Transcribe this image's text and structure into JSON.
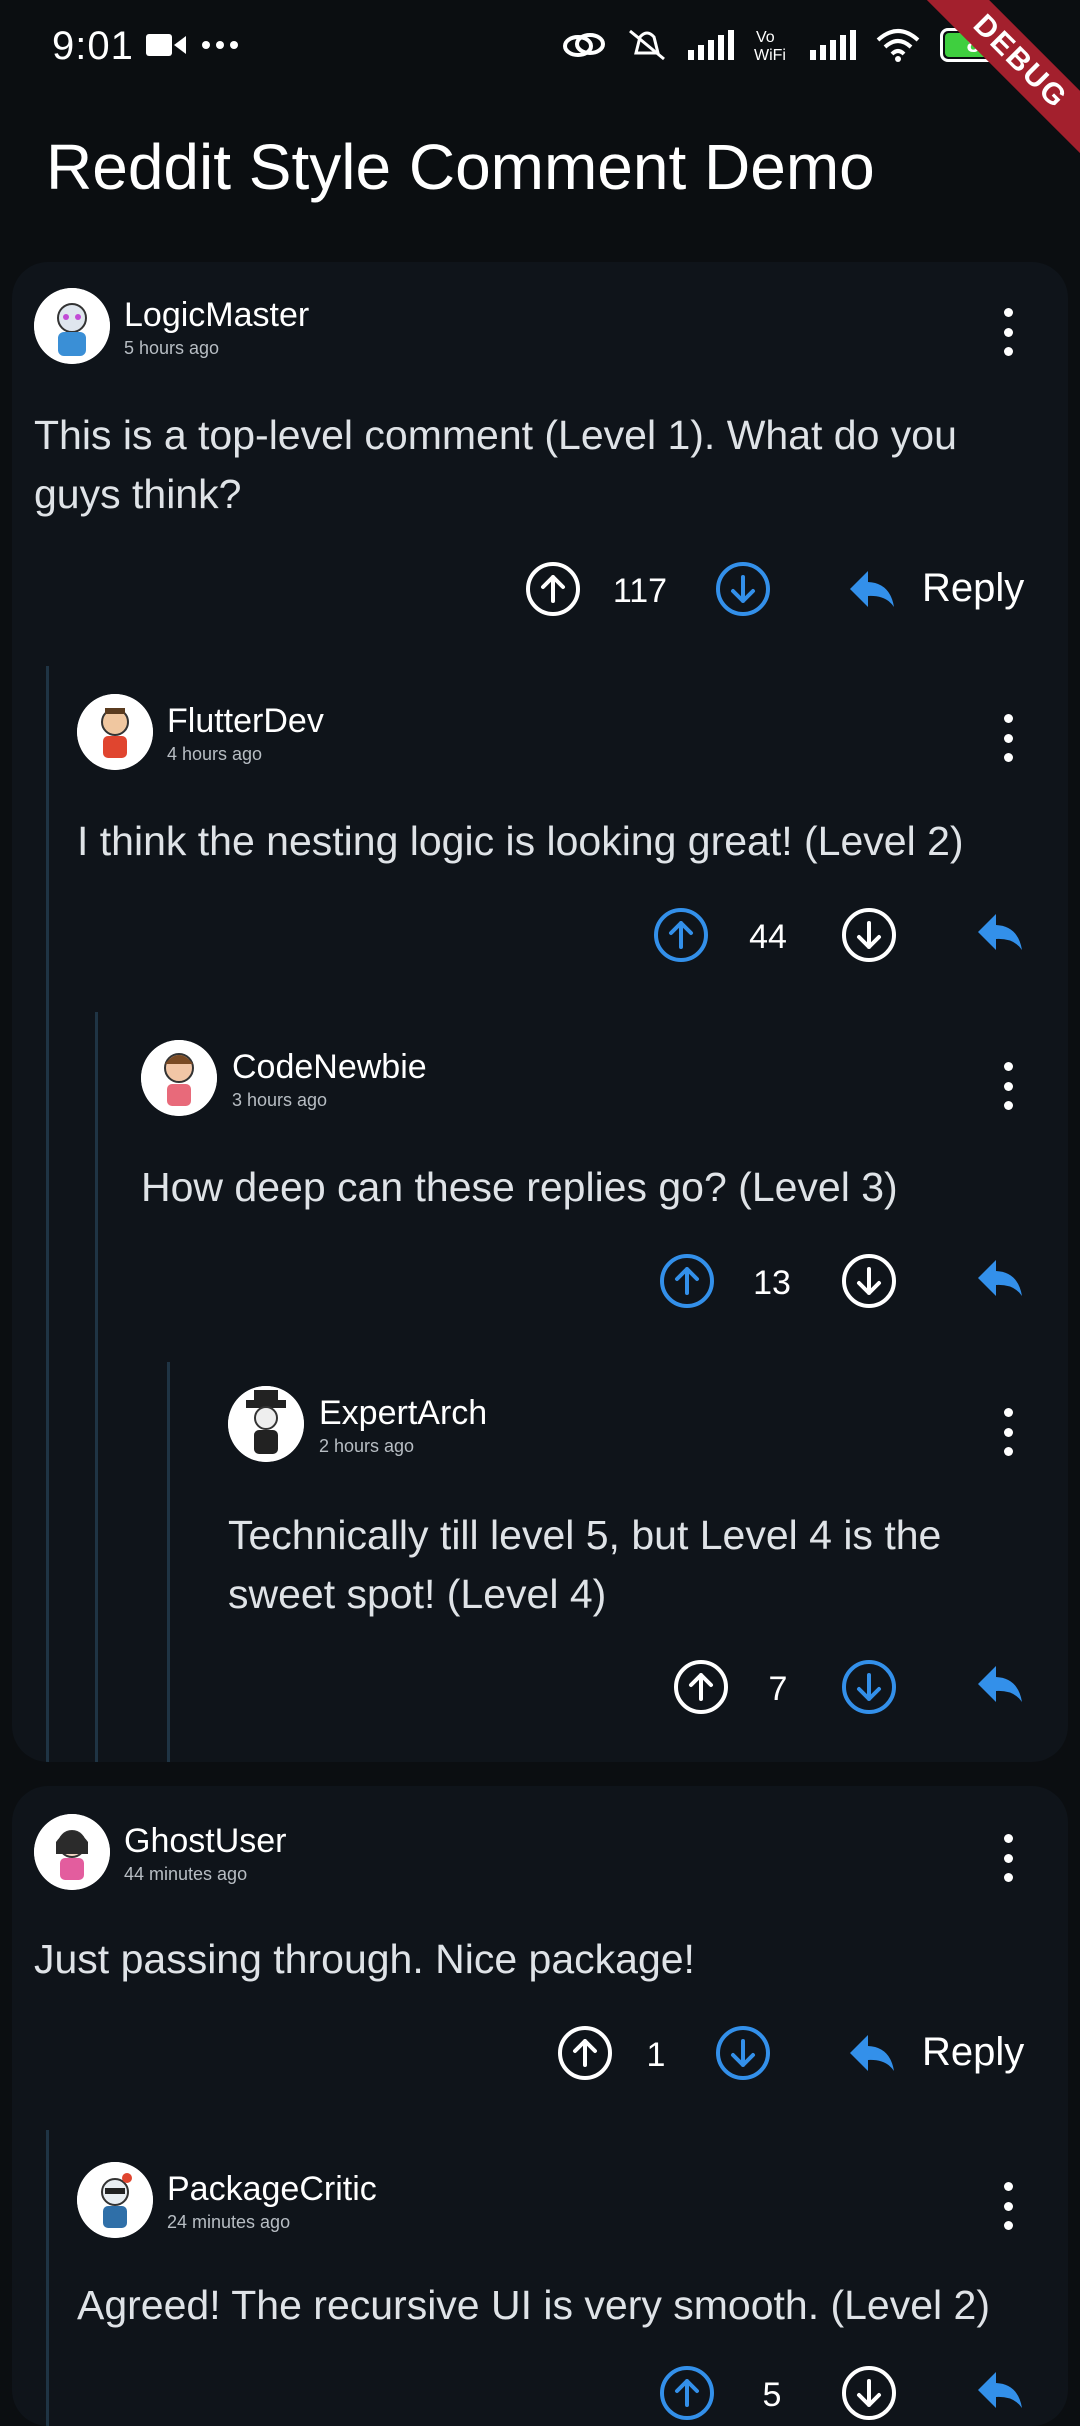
{
  "status_bar": {
    "time": "9:01",
    "battery": "86",
    "debug_banner": "DEBUG"
  },
  "app": {
    "title": "Reddit Style Comment Demo"
  },
  "comments": [
    {
      "username": "LogicMaster",
      "time": "5 hours ago",
      "body_lines": [
        "This is a top-level comment (Level 1). What do you",
        "guys think?"
      ],
      "votes": "117",
      "reply_label": "Reply"
    },
    {
      "username": "FlutterDev",
      "time": "4 hours ago",
      "body_lines": [
        "I think the nesting logic is looking great! (Level 2)"
      ],
      "votes": "44"
    },
    {
      "username": "CodeNewbie",
      "time": "3 hours ago",
      "body_lines": [
        "How deep can these replies go? (Level 3)"
      ],
      "votes": "13"
    },
    {
      "username": "ExpertArch",
      "time": "2 hours ago",
      "body_lines": [
        "Technically till level 5, but Level 4 is the",
        "sweet spot! (Level 4)"
      ],
      "votes": "7"
    },
    {
      "username": "GhostUser",
      "time": "44 minutes ago",
      "body_lines": [
        "Just passing through. Nice package!"
      ],
      "votes": "1",
      "reply_label": "Reply"
    },
    {
      "username": "PackageCritic",
      "time": "24 minutes ago",
      "body_lines": [
        "Agreed! The recursive UI is very smooth. (Level 2)"
      ],
      "votes": "5"
    }
  ],
  "colors": {
    "accent": "#3390ea",
    "background": "#0b0e11",
    "card": "#0f141a",
    "thread_line": "#1f3444"
  }
}
